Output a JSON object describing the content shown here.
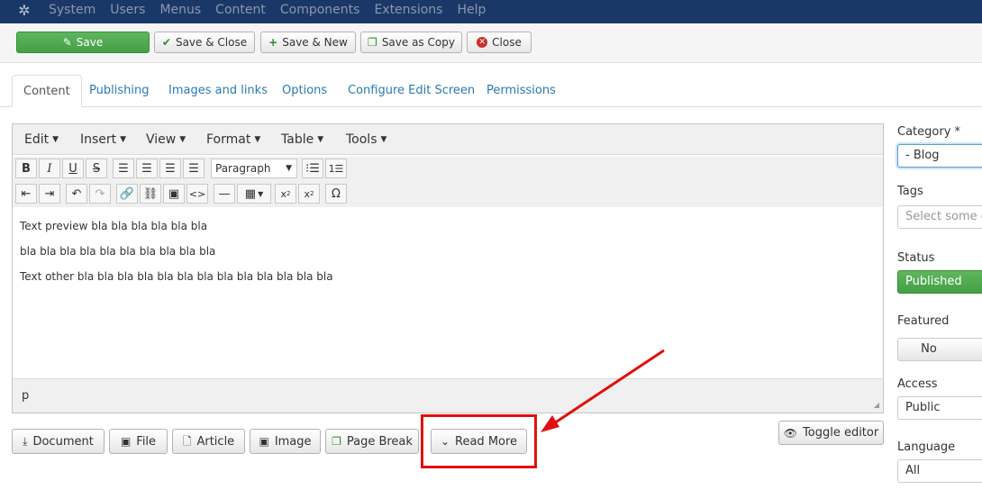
{
  "navbar": {
    "menu": [
      "System",
      "Users",
      "Menus",
      "Content",
      "Components",
      "Extensions",
      "Help"
    ]
  },
  "toolbar": {
    "save": "Save",
    "save_close": "Save & Close",
    "save_new": "Save & New",
    "save_copy": "Save as Copy",
    "close": "Close"
  },
  "tabs": [
    "Content",
    "Publishing",
    "Images and links",
    "Options",
    "Configure Edit Screen",
    "Permissions"
  ],
  "editor": {
    "menus": [
      "Edit",
      "Insert",
      "View",
      "Format",
      "Table",
      "Tools"
    ],
    "block_format": "Paragraph",
    "lines": [
      "Text preview   bla bla bla bla bla bla",
      "bla bla bla bla bla bla bla bla bla bla",
      "Text other   bla bla bla bla bla bla bla bla bla bla bla bla bla"
    ],
    "status_path": "p"
  },
  "bottom_buttons": {
    "document": "Document",
    "file": "File",
    "article": "Article",
    "image": "Image",
    "page_break": "Page Break",
    "read_more": "Read More",
    "toggle_editor": "Toggle editor"
  },
  "sidebar": {
    "category_label": "Category *",
    "category_value": "- Blog",
    "tags_label": "Tags",
    "tags_placeholder": "Select some op",
    "status_label": "Status",
    "status_value": "Published",
    "featured_label": "Featured",
    "featured_value": "No",
    "access_label": "Access",
    "access_value": "Public",
    "language_label": "Language",
    "language_value": "All"
  },
  "colors": {
    "navbar": "#1a3867",
    "success": "#46a546",
    "link": "#2a7ab0",
    "annotation": "#e01010"
  }
}
